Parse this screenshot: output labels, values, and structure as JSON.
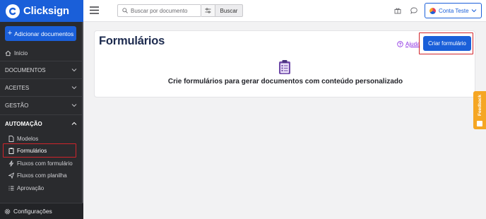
{
  "brand": {
    "name": "Clicksign"
  },
  "sidebar": {
    "add_button": "Adicionar documentos",
    "home": "Início",
    "sections": [
      {
        "label": "DOCUMENTOS"
      },
      {
        "label": "ACEITES"
      },
      {
        "label": "GESTÃO"
      },
      {
        "label": "AUTOMAÇÃO"
      }
    ],
    "automation_items": [
      {
        "label": "Modelos",
        "icon": "document-icon"
      },
      {
        "label": "Formulários",
        "icon": "clipboard-icon",
        "active": true
      },
      {
        "label": "Fluxos com formulário",
        "icon": "bolt-icon"
      },
      {
        "label": "Fluxos com planilha",
        "icon": "send-icon"
      },
      {
        "label": "Aprovação",
        "icon": "list-icon"
      }
    ],
    "settings": "Configurações"
  },
  "topbar": {
    "search_placeholder": "Buscar por documento",
    "search_button": "Buscar",
    "account_label": "Conta Teste"
  },
  "main": {
    "title": "Formulários",
    "help_link": "Ajuda",
    "create_button": "Criar formulário",
    "empty_message": "Crie formulários para gerar documentos com conteúdo personalizado"
  },
  "feedback": {
    "label": "Feedback"
  },
  "colors": {
    "primary": "#1a5fd9",
    "sidebar": "#2a2b2e",
    "highlight": "#d0242b",
    "feedback": "#f5a623"
  }
}
